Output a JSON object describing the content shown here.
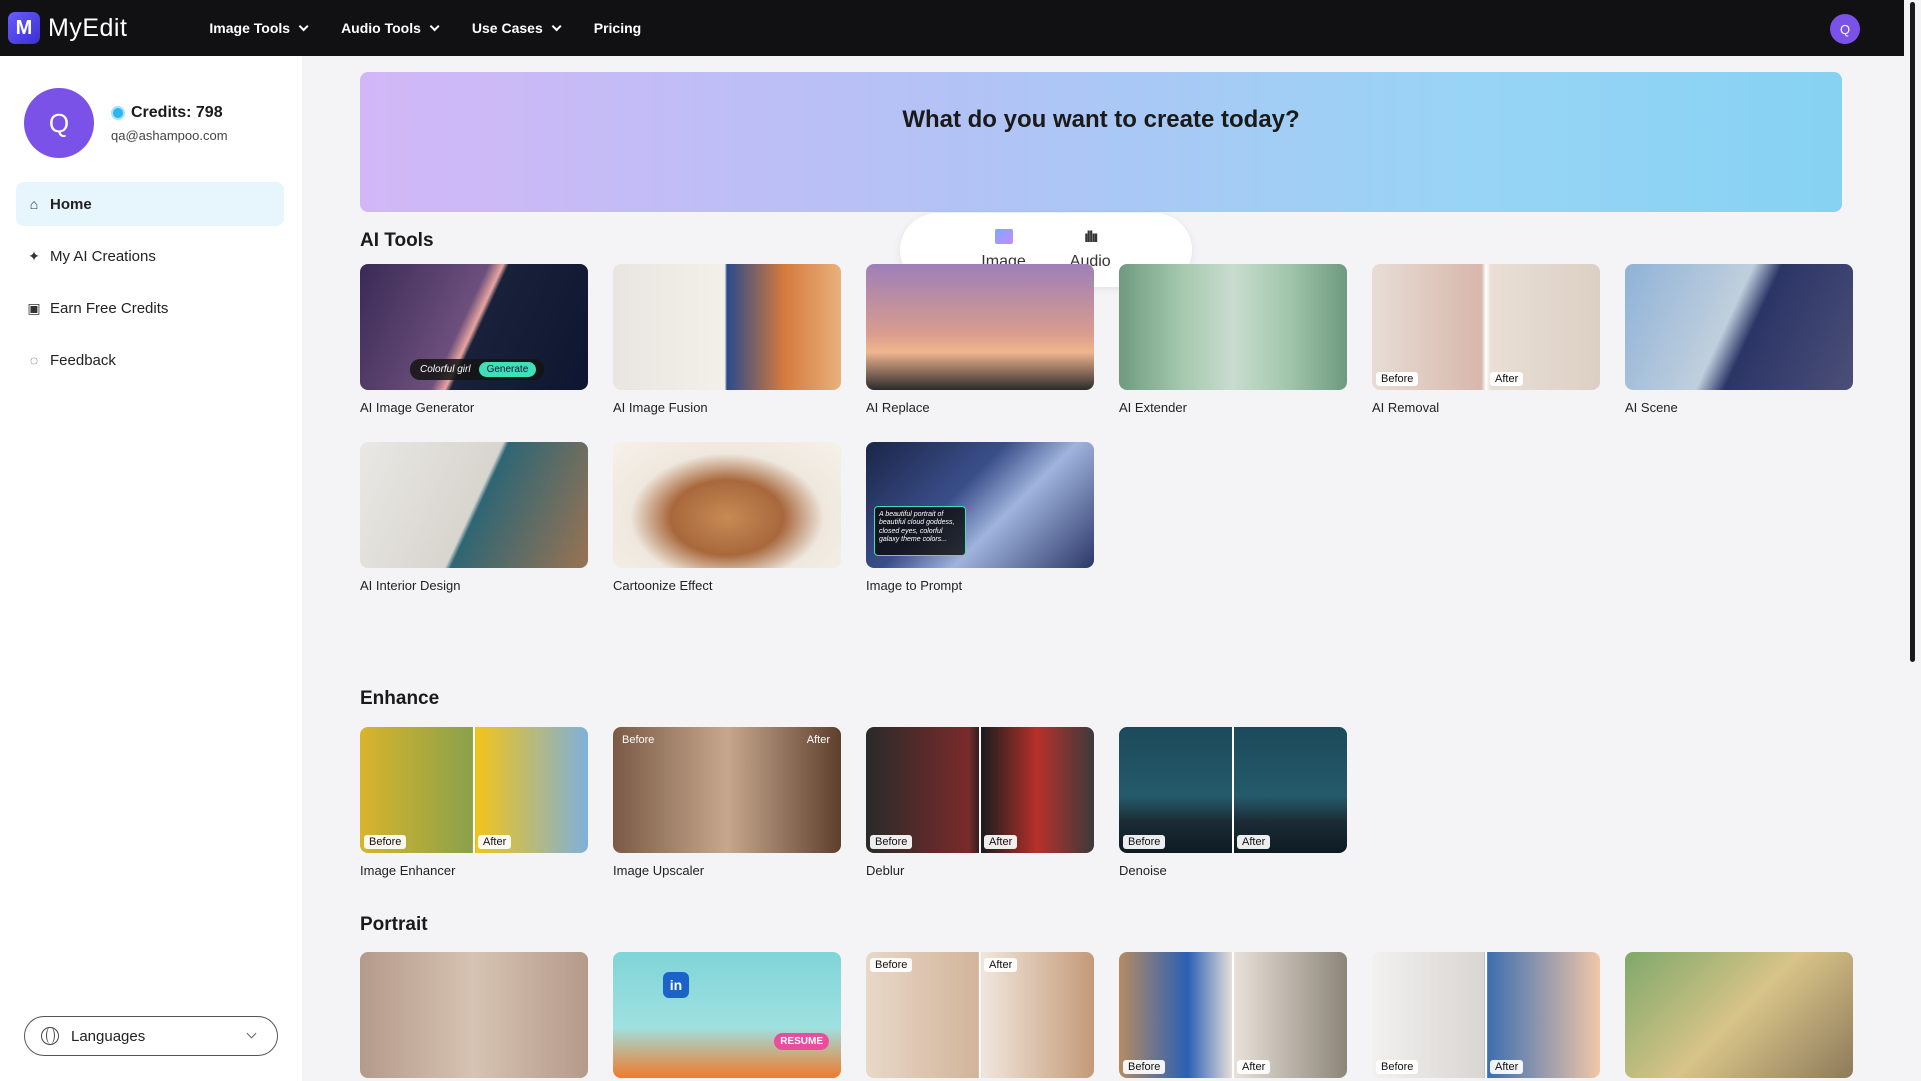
{
  "app": {
    "name": "MyEdit",
    "logo_letter": "M"
  },
  "nav": {
    "items": [
      {
        "label": "Image Tools",
        "dropdown": true
      },
      {
        "label": "Audio Tools",
        "dropdown": true
      },
      {
        "label": "Use Cases",
        "dropdown": true
      },
      {
        "label": "Pricing",
        "dropdown": false
      }
    ],
    "avatar_initial": "Q"
  },
  "profile": {
    "avatar_initial": "Q",
    "credits": "Credits: 798",
    "email": "qa@ashampoo.com"
  },
  "sidebar": {
    "items": [
      {
        "label": "Home",
        "icon": "home-icon",
        "active": true
      },
      {
        "label": "My AI Creations",
        "icon": "sparkle-icon",
        "active": false
      },
      {
        "label": "Earn Free Credits",
        "icon": "gift-icon",
        "active": false
      },
      {
        "label": "Feedback",
        "icon": "chat-bubble-icon",
        "active": false
      }
    ],
    "language_label": "Languages"
  },
  "hero": {
    "title": "What do you want to create today?",
    "tabs": [
      {
        "label": "Image",
        "icon": "image-icon",
        "active": true
      },
      {
        "label": "Audio",
        "icon": "waveform-icon",
        "active": false
      }
    ]
  },
  "sections": {
    "ai_tools": {
      "title": "AI Tools",
      "cards": [
        {
          "label": "AI Image Generator",
          "chip_text": "Colorful girl",
          "chip_button": "Generate"
        },
        {
          "label": "AI Image Fusion"
        },
        {
          "label": "AI Replace"
        },
        {
          "label": "AI Extender"
        },
        {
          "label": "AI Removal",
          "before": "Before",
          "after": "After"
        },
        {
          "label": "AI Scene"
        },
        {
          "label": "AI Interior Design"
        },
        {
          "label": "Cartoonize Effect"
        },
        {
          "label": "Image to Prompt",
          "prompt_text": "A beautiful portrait of beautiful cloud goddess, closed eyes, colorful galaxy theme colors..."
        }
      ]
    },
    "enhance": {
      "title": "Enhance",
      "cards": [
        {
          "label": "Image Enhancer",
          "before": "Before",
          "after": "After"
        },
        {
          "label": "Image Upscaler",
          "before": "Before",
          "after": "After"
        },
        {
          "label": "Deblur",
          "before": "Before",
          "after": "After"
        },
        {
          "label": "Denoise",
          "before": "Before",
          "after": "After"
        }
      ]
    },
    "portrait": {
      "title": "Portrait",
      "cards": [
        {
          "label": ""
        },
        {
          "label": "",
          "badge": "RESUME",
          "li": "in"
        },
        {
          "label": "",
          "before": "Before",
          "after": "After"
        },
        {
          "label": "",
          "before": "Before",
          "after": "After"
        },
        {
          "label": "",
          "before": "Before",
          "after": "After"
        },
        {
          "label": ""
        }
      ]
    }
  },
  "colors": {
    "accent": "#7b52e8",
    "topbar": "#111113",
    "active_bg": "#e7f5fd"
  }
}
